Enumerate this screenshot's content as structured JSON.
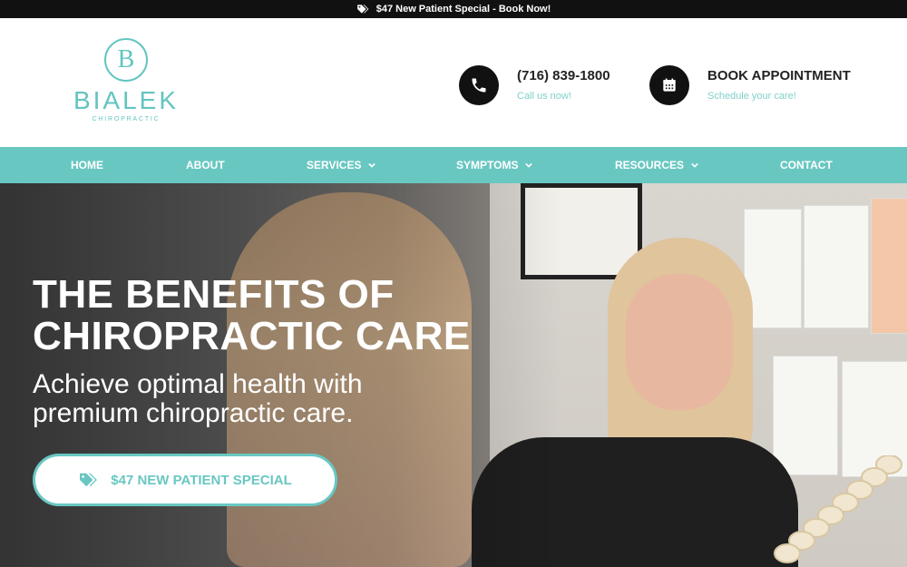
{
  "promo_bar": {
    "text": "$47 New Patient Special - Book Now!",
    "icon": "tag-icon"
  },
  "logo": {
    "monogram": "B",
    "name": "BIALEK",
    "subtitle": "CHIROPRACTIC"
  },
  "contact": {
    "phone": {
      "title": "(716) 839-1800",
      "subtitle": "Call us now!",
      "icon": "phone-icon"
    },
    "appointment": {
      "title": "BOOK APPOINTMENT",
      "subtitle": "Schedule your care!",
      "icon": "calendar-icon"
    }
  },
  "nav": {
    "items": [
      {
        "label": "HOME"
      },
      {
        "label": "ABOUT"
      },
      {
        "label": "SERVICES"
      },
      {
        "label": "SYMPTOMS"
      },
      {
        "label": "RESOURCES"
      },
      {
        "label": "CONTACT"
      }
    ]
  },
  "hero": {
    "title_line1": "THE BENEFITS OF",
    "title_line2": "CHIROPRACTIC CARE",
    "subtitle_line1": "Achieve optimal health with",
    "subtitle_line2": "premium chiropractic care.",
    "cta_label": "$47 NEW PATIENT SPECIAL"
  },
  "colors": {
    "accent": "#69c7c2",
    "dark": "#111111",
    "white": "#ffffff"
  }
}
